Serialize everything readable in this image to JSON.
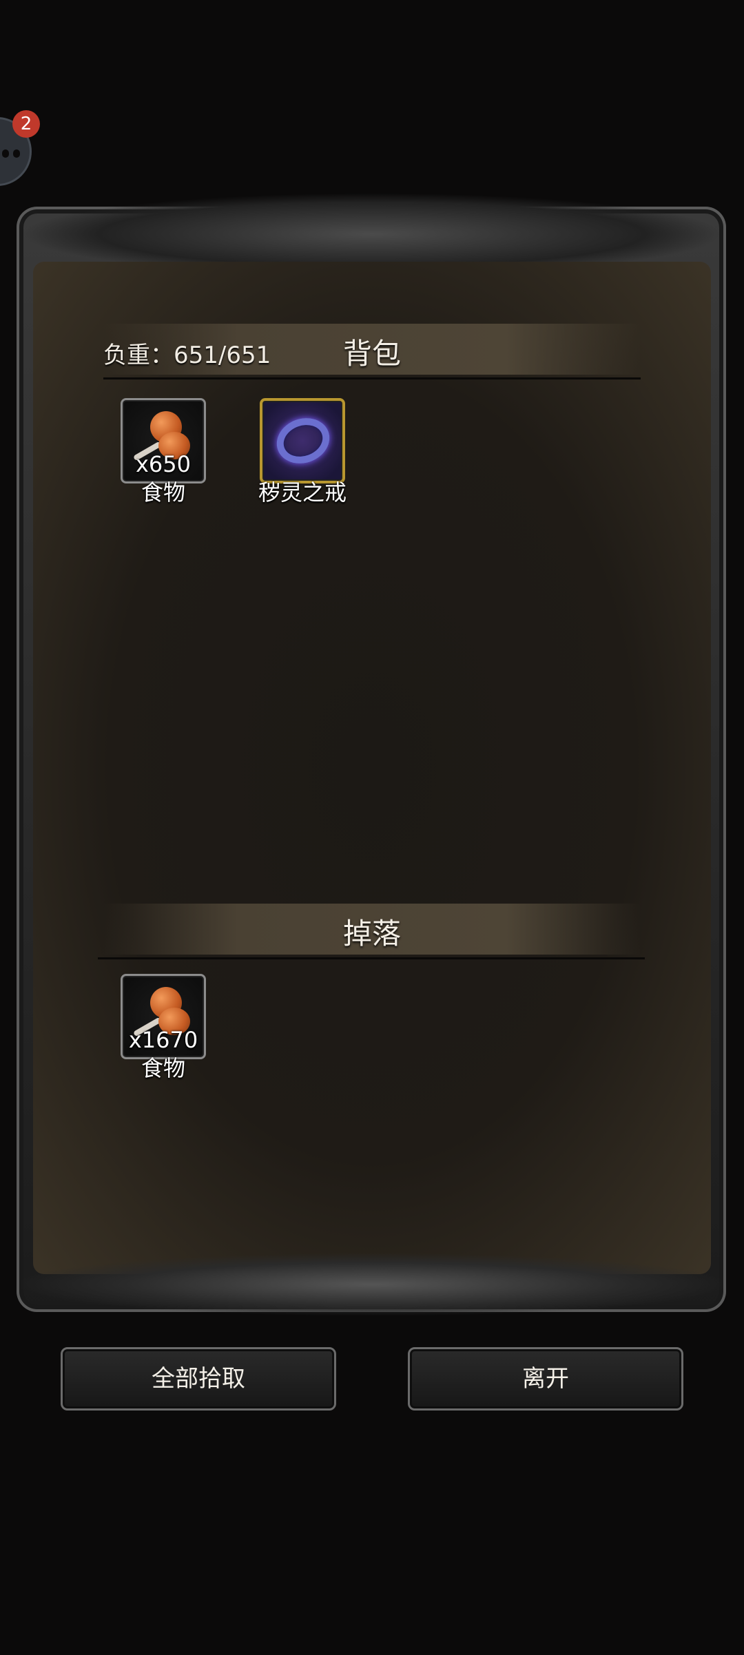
{
  "notification": {
    "badge_count": "2",
    "icon": "avatar-face-icon"
  },
  "backpack": {
    "title": "背包",
    "weight_label": "负重：651/651",
    "items": [
      {
        "icon": "roast-meat-icon",
        "quantity": "x650",
        "name": "食物"
      },
      {
        "icon": "ring-icon",
        "quantity": "",
        "name": "秽灵之戒",
        "rarity_color": "#b8972f"
      }
    ]
  },
  "drops": {
    "title": "掉落",
    "items": [
      {
        "icon": "roast-meat-icon",
        "quantity": "x1670",
        "name": "食物"
      }
    ]
  },
  "buttons": {
    "pick_all": "全部拾取",
    "leave": "离开"
  }
}
